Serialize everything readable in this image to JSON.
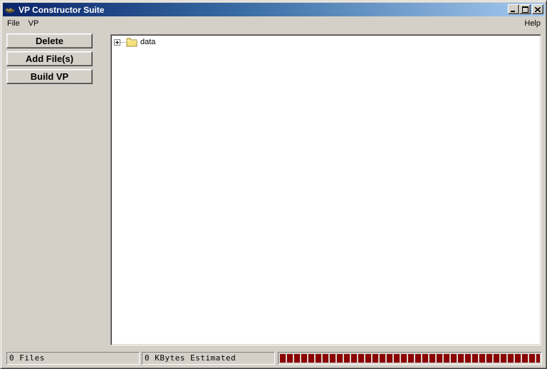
{
  "window": {
    "title": "VP Constructor Suite"
  },
  "menu": {
    "items": [
      "File",
      "VP"
    ],
    "help": "Help"
  },
  "buttons": {
    "delete": "Delete",
    "add_files": "Add File(s)",
    "build_vp": "Build VP"
  },
  "tree": {
    "root_label": "data",
    "root_expanded": false
  },
  "status": {
    "files": "0 Files",
    "kbytes": "0 KBytes Estimated"
  },
  "progress": {
    "fill_fraction": 1.0,
    "color": "#8b0000"
  },
  "icons": {
    "app": "app-icon",
    "folder": "folder-icon",
    "expand": "plus-expander-icon"
  }
}
